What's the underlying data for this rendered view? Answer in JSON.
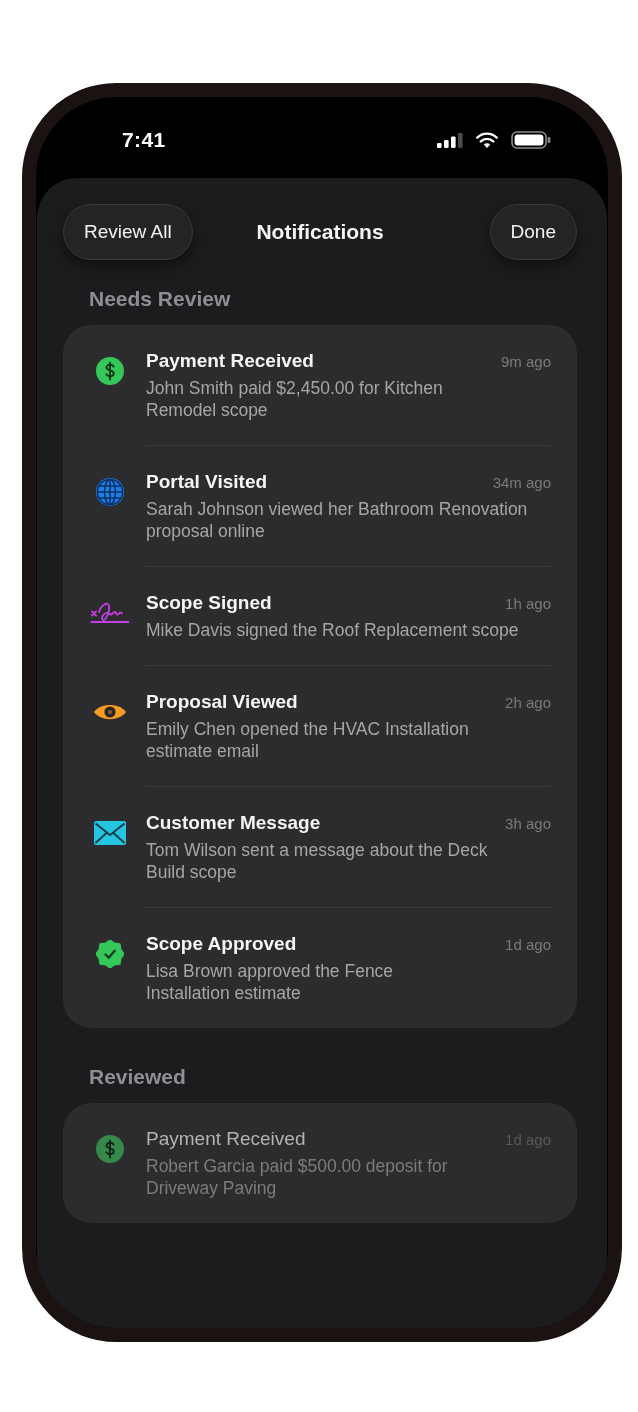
{
  "status_bar": {
    "time": "7:41"
  },
  "header": {
    "left_button": "Review All",
    "title": "Notifications",
    "right_button": "Done"
  },
  "sections": [
    {
      "title": "Needs Review",
      "items": [
        {
          "kind": "payment",
          "title": "Payment Received",
          "time": "9m ago",
          "message": "John Smith paid $2,450.00 for Kitchen\nRemodel scope",
          "unread": true
        },
        {
          "kind": "portal",
          "title": "Portal Visited",
          "time": "34m ago",
          "message": "Sarah Johnson viewed her Bathroom Renovation\nproposal online",
          "unread": true
        },
        {
          "kind": "signature",
          "title": "Scope Signed",
          "time": "1h ago",
          "message": "Mike Davis signed the Roof Replacement scope",
          "unread": true
        },
        {
          "kind": "view",
          "title": "Proposal Viewed",
          "time": "2h ago",
          "message": "Emily Chen opened the HVAC Installation\nestimate email",
          "unread": true
        },
        {
          "kind": "message",
          "title": "Customer Message",
          "time": "3h ago",
          "message": "Tom Wilson sent a message about the Deck\nBuild scope",
          "unread": true
        },
        {
          "kind": "approved",
          "title": "Scope Approved",
          "time": "1d ago",
          "message": "Lisa Brown approved the Fence\nInstallation estimate",
          "unread": true
        }
      ]
    },
    {
      "title": "Reviewed",
      "items": [
        {
          "kind": "payment",
          "title": "Payment Received",
          "time": "1d ago",
          "message": "Robert Garcia paid $500.00 deposit for\nDriveway Paving",
          "unread": false
        }
      ]
    }
  ]
}
